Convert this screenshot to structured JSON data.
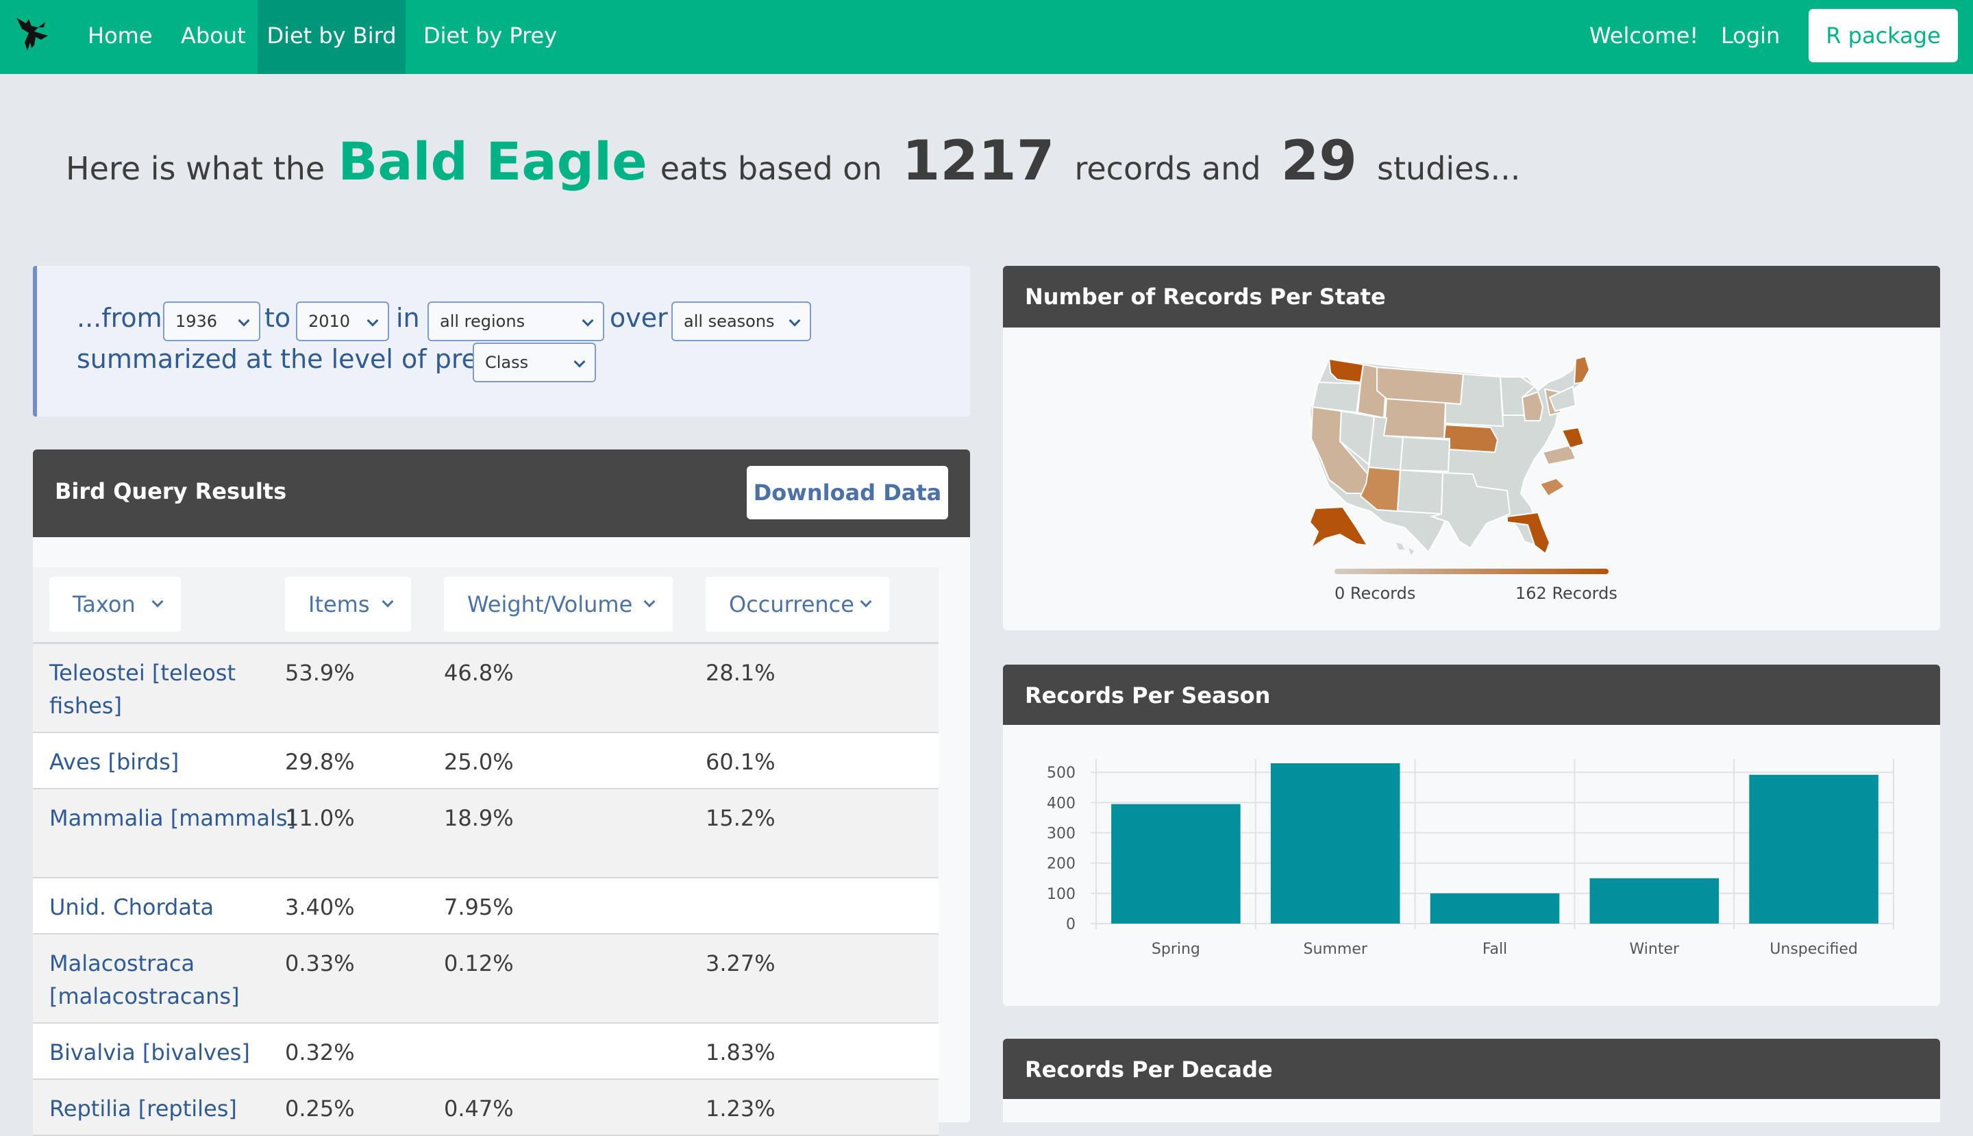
{
  "nav": {
    "links": [
      "Home",
      "About",
      "Diet by Bird",
      "Diet by Prey"
    ],
    "welcome": "Welcome!",
    "login": "Login",
    "button": "R package"
  },
  "headline": {
    "p1": "Here is what the",
    "bird": "Bald Eagle",
    "p2": "eats based on",
    "records": "1217",
    "p3": "records and",
    "studies": "29",
    "p4": "studies..."
  },
  "filters": {
    "from_label": "...from",
    "from_value": "1936",
    "to_label": "to",
    "to_value": "2010",
    "in_label": "in",
    "region_value": "all regions",
    "over_label": "over",
    "season_value": "all seasons",
    "level_label": "summarized at the level of prey",
    "level_value": "Class"
  },
  "results": {
    "title": "Bird Query Results",
    "download": "Download Data",
    "columns": [
      "Taxon",
      "Items",
      "Weight/Volume",
      "Occurrence"
    ],
    "rows": [
      {
        "taxon": "Teleostei [teleost fishes]",
        "items": "53.9%",
        "weight": "46.8%",
        "occurrence": "28.1%"
      },
      {
        "taxon": "Aves [birds]",
        "items": "29.8%",
        "weight": "25.0%",
        "occurrence": "60.1%"
      },
      {
        "taxon": "Mammalia [mammals]",
        "items": "11.0%",
        "weight": "18.9%",
        "occurrence": "15.2%"
      },
      {
        "taxon": "Unid. Chordata",
        "items": "3.40%",
        "weight": "7.95%",
        "occurrence": ""
      },
      {
        "taxon": "Malacostraca [malacostracans]",
        "items": "0.33%",
        "weight": "0.12%",
        "occurrence": "3.27%"
      },
      {
        "taxon": "Bivalvia [bivalves]",
        "items": "0.32%",
        "weight": "",
        "occurrence": "1.83%"
      },
      {
        "taxon": "Reptilia [reptiles]",
        "items": "0.25%",
        "weight": "0.47%",
        "occurrence": "1.23%"
      }
    ]
  },
  "map_card": {
    "title": "Number of Records Per State",
    "legend_min": "0 Records",
    "legend_max": "162 Records",
    "colors": {
      "low": "#d4cdc4",
      "high": "#b5530a",
      "none": "#d3d9d6"
    }
  },
  "season_card": {
    "title": "Records Per Season"
  },
  "decade_card": {
    "title": "Records Per Decade"
  },
  "chart_data": {
    "type": "bar",
    "categories": [
      "Spring",
      "Summer",
      "Fall",
      "Winter",
      "Unspecified"
    ],
    "values": [
      395,
      530,
      100,
      150,
      492
    ],
    "ylim": [
      0,
      530
    ],
    "yticks": [
      0,
      100,
      200,
      300,
      400,
      500
    ],
    "grid": true,
    "bar_color": "#038f9c"
  }
}
